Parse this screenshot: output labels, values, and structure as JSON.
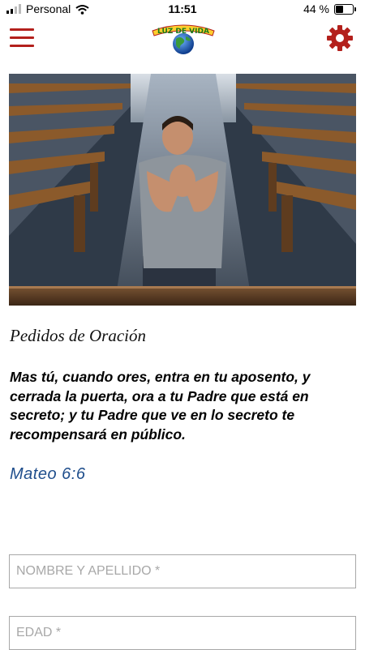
{
  "status_bar": {
    "carrier": "Personal",
    "time": "11:51",
    "battery_text": "44 %",
    "battery_level": 0.44
  },
  "header": {
    "logo_text": "LUZ DE VIDA",
    "menu_icon": "hamburger-menu-icon",
    "settings_icon": "gear-icon",
    "accent_color": "#b3201c"
  },
  "page": {
    "title": "Pedidos de Oración",
    "verse": "Mas tú, cuando ores, entra en tu aposento, y cerrada la puerta, ora a tu Padre que está en secreto; y tu Padre que ve en lo secreto te recompensará en público.",
    "reference": "Mateo 6:6",
    "reference_color": "#1f4e8c"
  },
  "form": {
    "name_placeholder": "NOMBRE Y APELLIDO *",
    "name_value": "",
    "age_placeholder": "EDAD *",
    "age_value": ""
  }
}
